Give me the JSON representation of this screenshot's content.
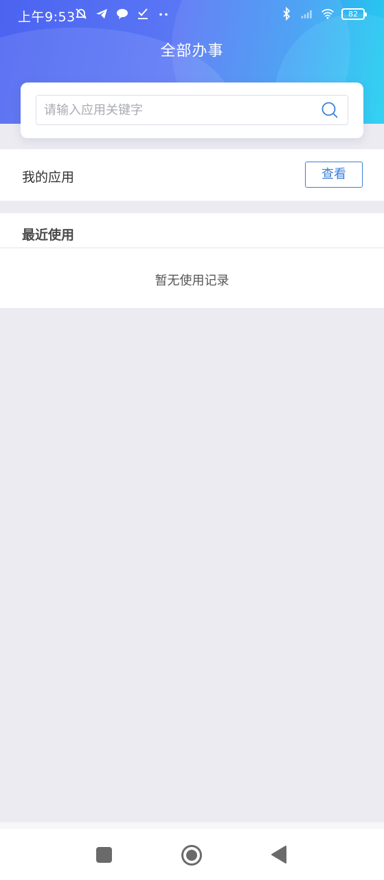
{
  "status_bar": {
    "time": "上午9:53",
    "battery": "82",
    "icons": [
      "mute-bell-icon",
      "telegram-icon",
      "chat-bubble-icon",
      "download-check-icon",
      "more-dots-icon",
      "bluetooth-icon",
      "signal-icon",
      "wifi-icon",
      "battery-icon"
    ]
  },
  "header": {
    "title": "全部办事"
  },
  "search": {
    "placeholder": "请输入应用关键字",
    "value": "",
    "icon": "search-icon"
  },
  "my_apps": {
    "label": "我的应用",
    "button_label": "查看"
  },
  "recent": {
    "title": "最近使用",
    "empty_text": "暂无使用记录"
  },
  "nav_bar": {
    "icons": [
      "recent-apps-icon",
      "home-icon",
      "back-icon"
    ]
  },
  "colors": {
    "header_gradient": [
      "#4b63f0",
      "#22d0ef"
    ],
    "accent": "#3a7fd6",
    "page_bg": "#ecebf1"
  }
}
